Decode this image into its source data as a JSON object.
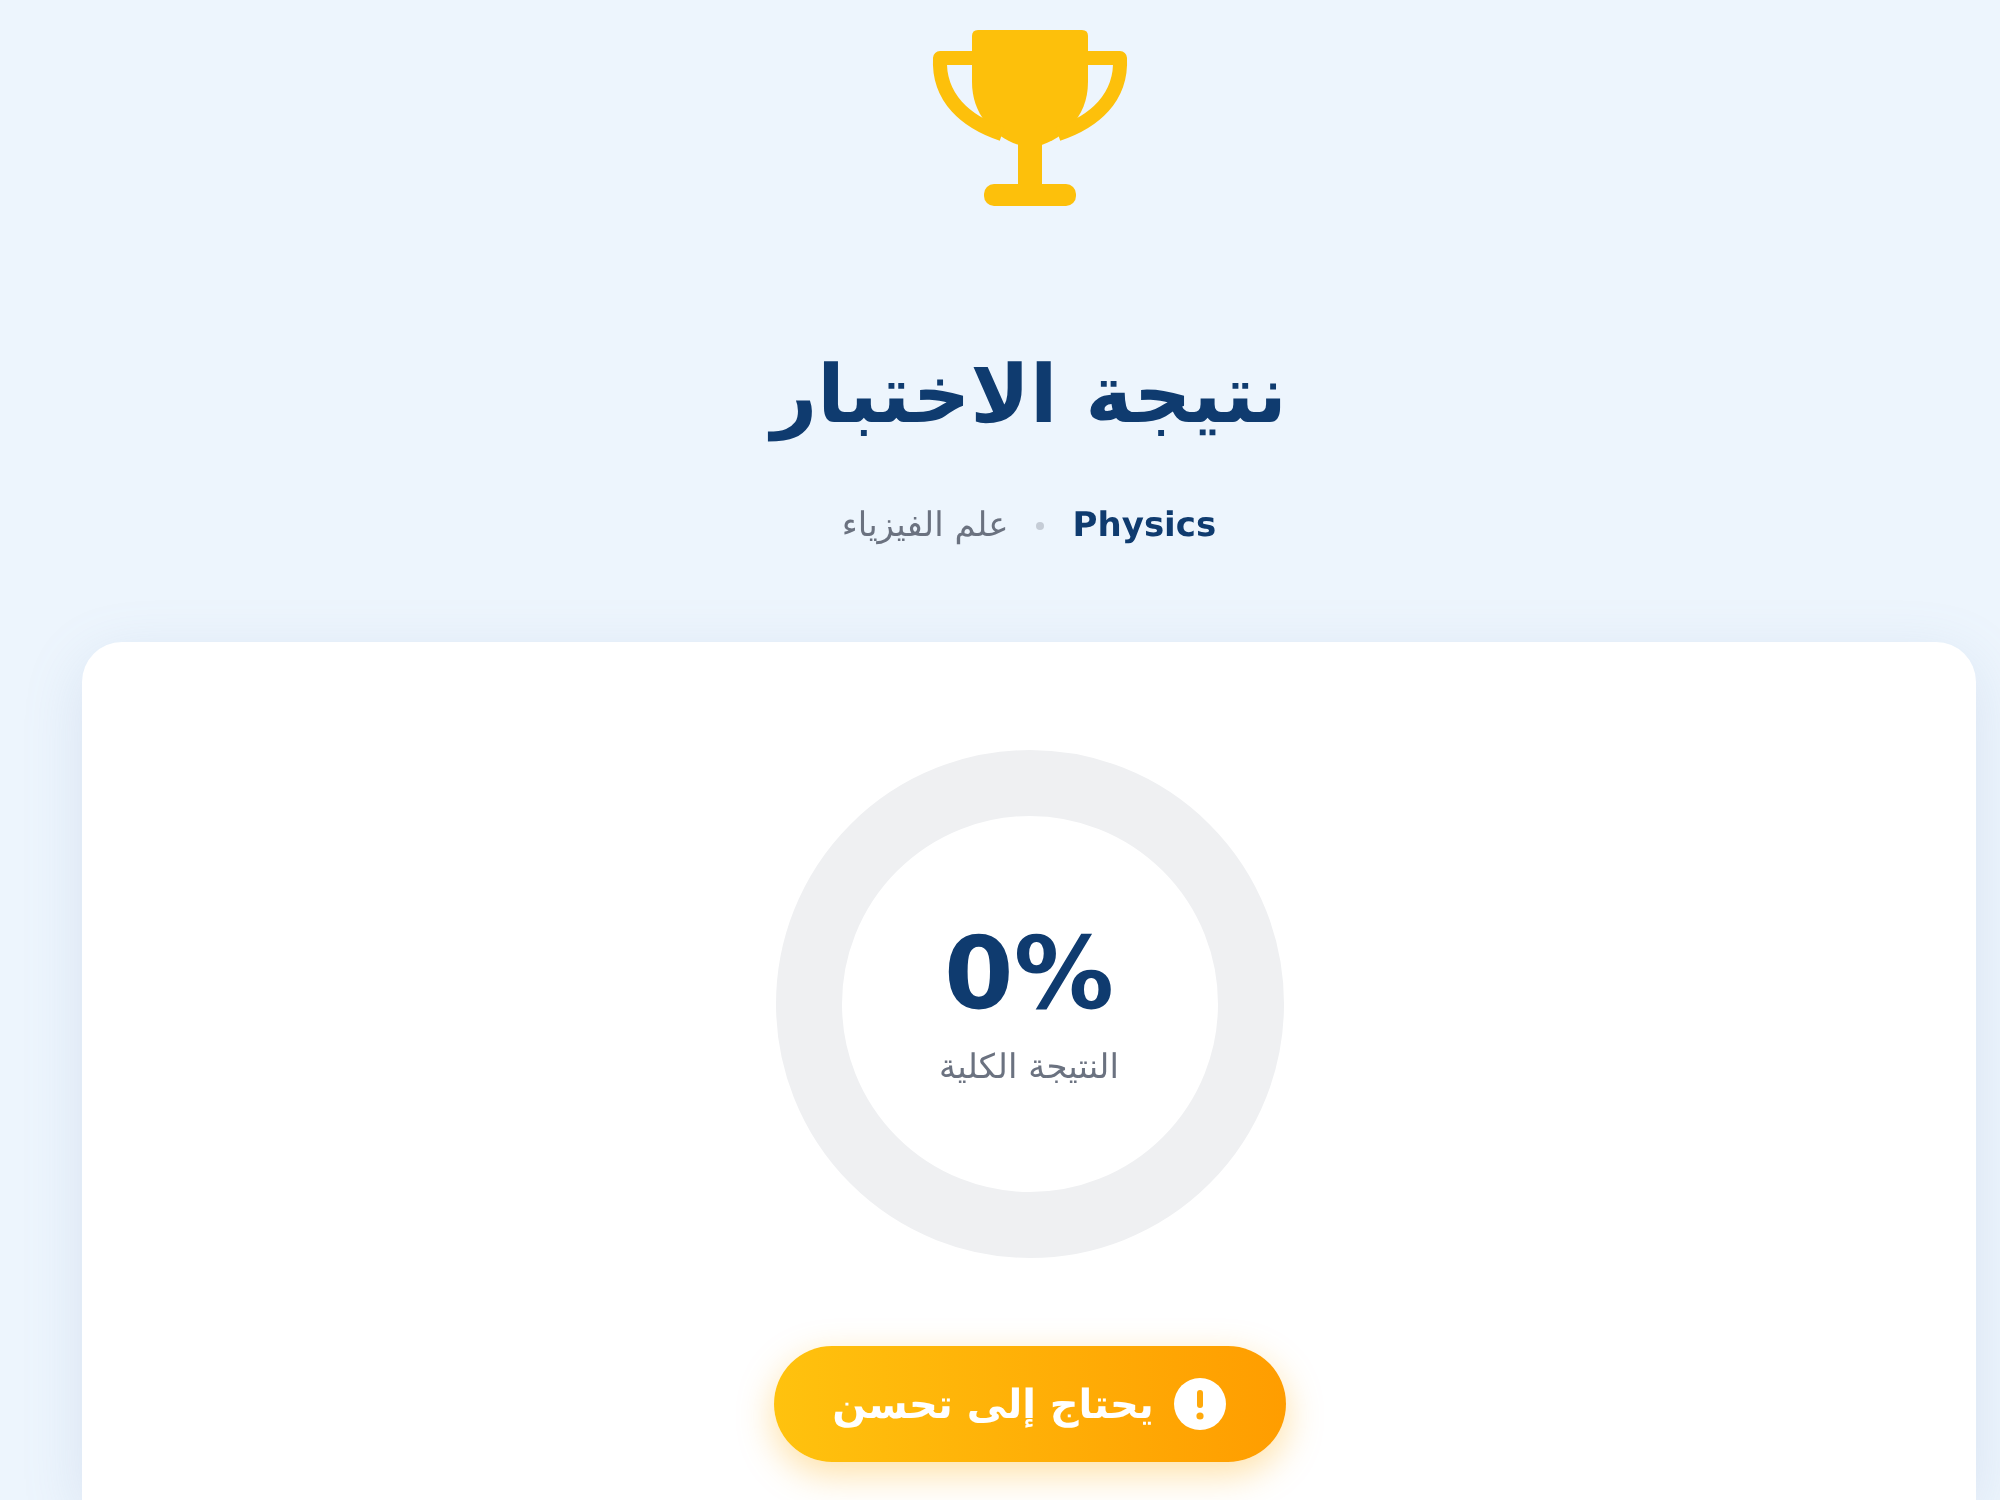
{
  "header": {
    "title": "نتيجة الاختبار",
    "subject": {
      "name": "Physics",
      "name_local": "علم الفيزياء"
    }
  },
  "result": {
    "score": {
      "value": "0%",
      "label": "النتيجة الكلية"
    },
    "status": {
      "kind": "warning",
      "label": "يحتاج إلى تحسن"
    }
  }
}
